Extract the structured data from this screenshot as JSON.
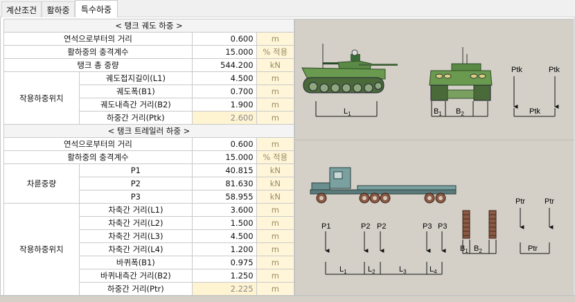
{
  "tabs": [
    "계산조건",
    "활하중",
    "특수하중"
  ],
  "track": {
    "header": "< 탱크 궤도 하중 >",
    "rows": [
      {
        "label": "연석으로부터의 거리",
        "value": "0.600",
        "unit": "m"
      },
      {
        "label": "활하중의 충격계수",
        "value": "15.000",
        "unit": "% 적용"
      },
      {
        "label": "탱크 총 중량",
        "value": "544.200",
        "unit": "kN"
      }
    ],
    "group_label": "작용하중위치",
    "group_rows": [
      {
        "label": "궤도접지길이(L1)",
        "value": "4.500",
        "unit": "m"
      },
      {
        "label": "궤도폭(B1)",
        "value": "0.700",
        "unit": "m"
      },
      {
        "label": "궤도내측간 거리(B2)",
        "value": "1.900",
        "unit": "m"
      },
      {
        "label": "하중간 거리(Ptk)",
        "value": "2.600",
        "unit": "m"
      }
    ]
  },
  "trailer": {
    "header": "< 탱크 트레일러 하중 >",
    "rows": [
      {
        "label": "연석으로부터의 거리",
        "value": "0.600",
        "unit": "m"
      },
      {
        "label": "활하중의 충격계수",
        "value": "15.000",
        "unit": "% 적용"
      }
    ],
    "wheel_group_label": "차륜중량",
    "wheel_rows": [
      {
        "label": "P1",
        "value": "40.815",
        "unit": "kN"
      },
      {
        "label": "P2",
        "value": "81.630",
        "unit": "kN"
      },
      {
        "label": "P3",
        "value": "58.955",
        "unit": "kN"
      }
    ],
    "group_label": "작용하중위치",
    "group_rows": [
      {
        "label": "차축간 거리(L1)",
        "value": "3.600",
        "unit": "m"
      },
      {
        "label": "차축간 거리(L2)",
        "value": "1.500",
        "unit": "m"
      },
      {
        "label": "차축간 거리(L3)",
        "value": "4.500",
        "unit": "m"
      },
      {
        "label": "차축간 거리(L4)",
        "value": "1.200",
        "unit": "m"
      },
      {
        "label": "바퀴폭(B1)",
        "value": "0.975",
        "unit": "m"
      },
      {
        "label": "바퀴내측간 거리(B2)",
        "value": "1.250",
        "unit": "m"
      },
      {
        "label": "하중간 거리(Ptr)",
        "value": "2.225",
        "unit": "m"
      }
    ]
  },
  "diagram": {
    "tank_labels": {
      "L": "L",
      "L_sub": "1",
      "B1": "B",
      "B1_sub": "1",
      "B2": "B",
      "B2_sub": "2",
      "ptk": "Ptk"
    },
    "trailer_labels": {
      "P1": "P1",
      "P2": "P2",
      "P3": "P3",
      "L": "L",
      "sub1": "1",
      "sub2": "2",
      "sub3": "3",
      "sub4": "4",
      "B": "B",
      "ptr": "Ptr"
    },
    "colors": {
      "tank_body": "#6a9a50",
      "trailer": "#7aa0a0",
      "wheel": "#8a5a45",
      "bg": "#d4d0c8"
    }
  }
}
